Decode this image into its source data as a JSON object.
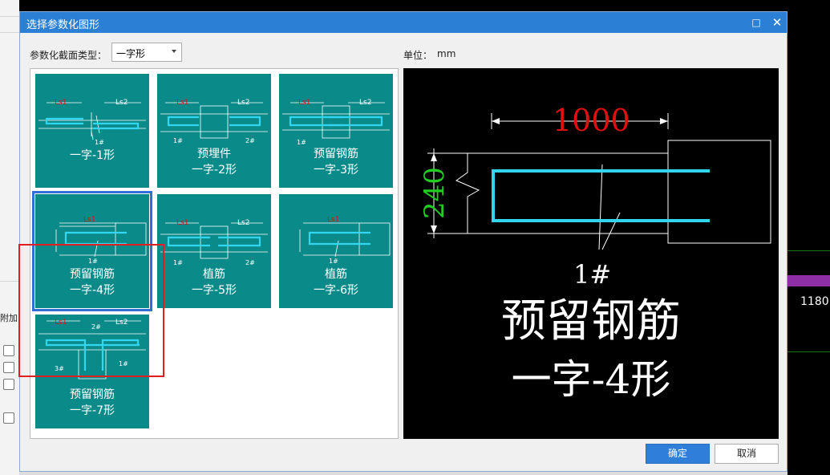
{
  "dialog": {
    "title": "选择参数化图形",
    "section_type_label": "参数化截面类型：",
    "section_type_value": "一字形",
    "unit_label": "单位：",
    "unit_value": "mm",
    "ok_label": "确定",
    "cancel_label": "取消"
  },
  "tiles": [
    {
      "line1": "一字-1形",
      "line2": "",
      "dims": {
        "a": "Ls1",
        "b": "Ls2",
        "c": "1#"
      }
    },
    {
      "line1": "预埋件",
      "line2": "一字-2形",
      "dims": {
        "a": "Ls1",
        "b": "Ls2",
        "c": "1#",
        "d": "2#"
      }
    },
    {
      "line1": "预留钢筋",
      "line2": "一字-3形",
      "dims": {
        "a": "Ls1",
        "b": "Ls2",
        "c": "1#"
      }
    },
    {
      "line1": "预留钢筋",
      "line2": "一字-4形",
      "dims": {
        "a": "Ls1",
        "c": "1#"
      }
    },
    {
      "line1": "植筋",
      "line2": "一字-5形",
      "dims": {
        "a": "Ls1",
        "b": "Ls2",
        "c": "1#",
        "d": "2#"
      }
    },
    {
      "line1": "植筋",
      "line2": "一字-6形",
      "dims": {
        "a": "Ls1",
        "c": "1#"
      }
    },
    {
      "line1": "预留钢筋",
      "line2": "一字-7形",
      "dims": {
        "a": "Ls1",
        "b": "Ls2",
        "c": "3#",
        "d": "2#",
        "e": "1#"
      }
    }
  ],
  "preview": {
    "dim_length": "1000",
    "dim_height": "240",
    "bar_label": "1#",
    "caption_line1": "预留钢筋",
    "caption_line2": "一字-4形"
  },
  "background": {
    "left_label": "附加",
    "right_number": "1180"
  },
  "colors": {
    "titlebar": "#2b7fd4",
    "tile": "#0b8a8a",
    "rebar": "#33d6f0",
    "dim_red": "#e01010",
    "dim_green": "#22cc22",
    "highlight": "#e02020",
    "selection": "#2f6fd6"
  }
}
